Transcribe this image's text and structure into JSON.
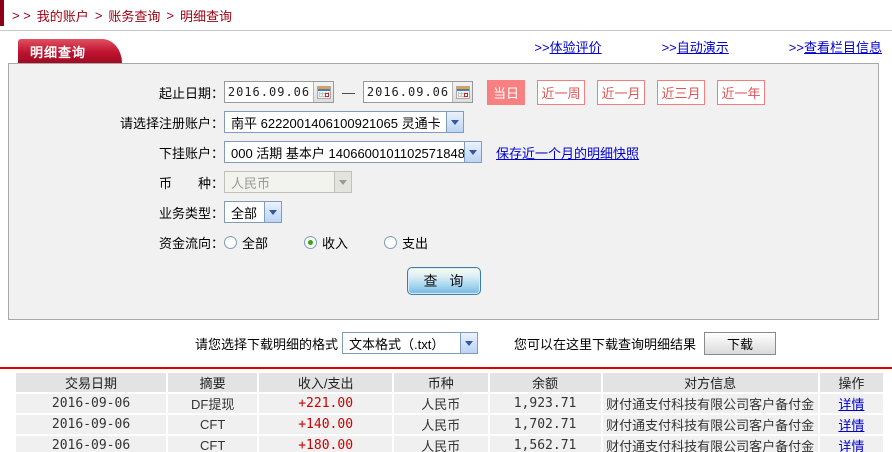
{
  "breadcrumb": {
    "prefix": "> >",
    "sep": ">",
    "items": [
      "我的账户",
      "账务查询",
      "明细查询"
    ]
  },
  "tab": {
    "title": "明细查询"
  },
  "header_links": [
    {
      "arrow": ">>",
      "label": "体验评价"
    },
    {
      "arrow": ">>",
      "label": "自动演示"
    },
    {
      "arrow": ">>",
      "label": "查看栏目信息"
    }
  ],
  "form": {
    "date_range": {
      "label": "起止日期：",
      "start": "2016.09.06",
      "end": "2016.09.06",
      "separator": "—"
    },
    "quick_buttons": [
      {
        "label": "当日",
        "active": true
      },
      {
        "label": "近一周",
        "active": false
      },
      {
        "label": "近一月",
        "active": false
      },
      {
        "label": "近三月",
        "active": false
      },
      {
        "label": "近一年",
        "active": false
      }
    ],
    "register_account": {
      "label": "请选择注册账户：",
      "value": "南平 6222001406100921065 灵通卡"
    },
    "sub_account": {
      "label": "下挂账户：",
      "value": "000 活期 基本户 1406600101102571848",
      "link": "保存近一个月的明细快照"
    },
    "currency": {
      "label": "币　　种：",
      "value": "人民币",
      "disabled": true
    },
    "business_type": {
      "label": "业务类型：",
      "value": "全部"
    },
    "fund_flow": {
      "label": "资金流向：",
      "options": [
        {
          "label": "全部",
          "checked": false
        },
        {
          "label": "收入",
          "checked": true
        },
        {
          "label": "支出",
          "checked": false
        }
      ]
    },
    "query_button": "查 询"
  },
  "download": {
    "format_label": "请您选择下载明细的格式",
    "format_value": "文本格式（.txt）",
    "hint": "您可以在这里下载查询明细结果",
    "button": "下载"
  },
  "table": {
    "headers": [
      "交易日期",
      "摘要",
      "收入/支出",
      "币种",
      "余额",
      "对方信息",
      "操作"
    ],
    "rows": [
      {
        "date": "2016-09-06",
        "summary": "DF提现",
        "amount": "+221.00",
        "currency": "人民币",
        "balance": "1,923.71",
        "counterparty": "财付通支付科技有限公司客户备付金",
        "action": "详情"
      },
      {
        "date": "2016-09-06",
        "summary": "CFT",
        "amount": "+140.00",
        "currency": "人民币",
        "balance": "1,702.71",
        "counterparty": "财付通支付科技有限公司客户备付金",
        "action": "详情"
      },
      {
        "date": "2016-09-06",
        "summary": "CFT",
        "amount": "+180.00",
        "currency": "人民币",
        "balance": "1,562.71",
        "counterparty": "财付通支付科技有限公司客户备付金",
        "action": "详情"
      }
    ]
  },
  "colors": {
    "brand_red": "#b01027",
    "breadcrumb_red": "#990011",
    "link_blue": "#0000cc",
    "amount_red": "#cc0000",
    "quick_button_salmon": "#f98080",
    "divider_red": "#e00000",
    "panel_gray": "#f1f1f1"
  }
}
